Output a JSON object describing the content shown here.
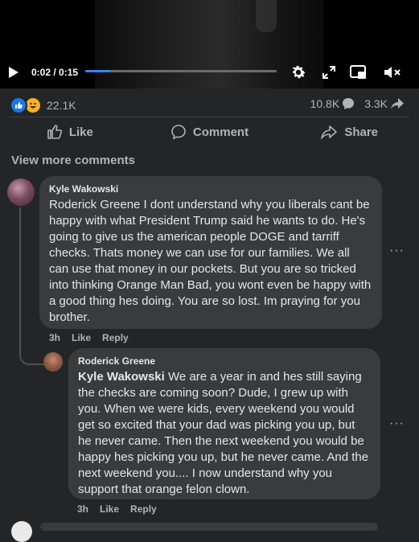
{
  "video": {
    "time": "0:02 / 0:15",
    "progress": 0.13,
    "icons": [
      "play-icon",
      "settings-gear-icon",
      "expand-icon",
      "pip-icon",
      "volume-muted-icon"
    ]
  },
  "reactions": {
    "count": "22.1K",
    "icons": [
      "like-reaction-icon",
      "haha-reaction-icon"
    ]
  },
  "stats": {
    "comments": "10.8K",
    "shares": "3.3K"
  },
  "actions": {
    "like": "Like",
    "comment": "Comment",
    "share": "Share"
  },
  "view_more": "View more comments",
  "comments": [
    {
      "author": "Kyle Wakowski",
      "text": "Roderick Greene I dont understand why you liberals cant be happy with what President Trump said he wants to do. He's going to give us the american people DOGE and tarriff checks. Thats money we can use for our families. We all can use that money in our pockets. But you are so tricked into thinking Orange Man Bad, you wont even be happy with a good thing hes doing. You are so lost. Im praying for you brother.",
      "time": "3h",
      "like": "Like",
      "reply": "Reply"
    },
    {
      "author": "Roderick Greene",
      "mention": "Kyle Wakowski",
      "text": " We are a year in and hes still saying the checks are coming soon? Dude, I grew up with you. When we were kids, every weekend you would get so excited that your dad was picking you up, but he never came. Then the next weekend you would be happy hes picking you up, but he never came. And the next weekend you.... I now understand why you support that orange felon clown.",
      "time": "3h",
      "like": "Like",
      "reply": "Reply"
    }
  ],
  "more_icon": "···"
}
